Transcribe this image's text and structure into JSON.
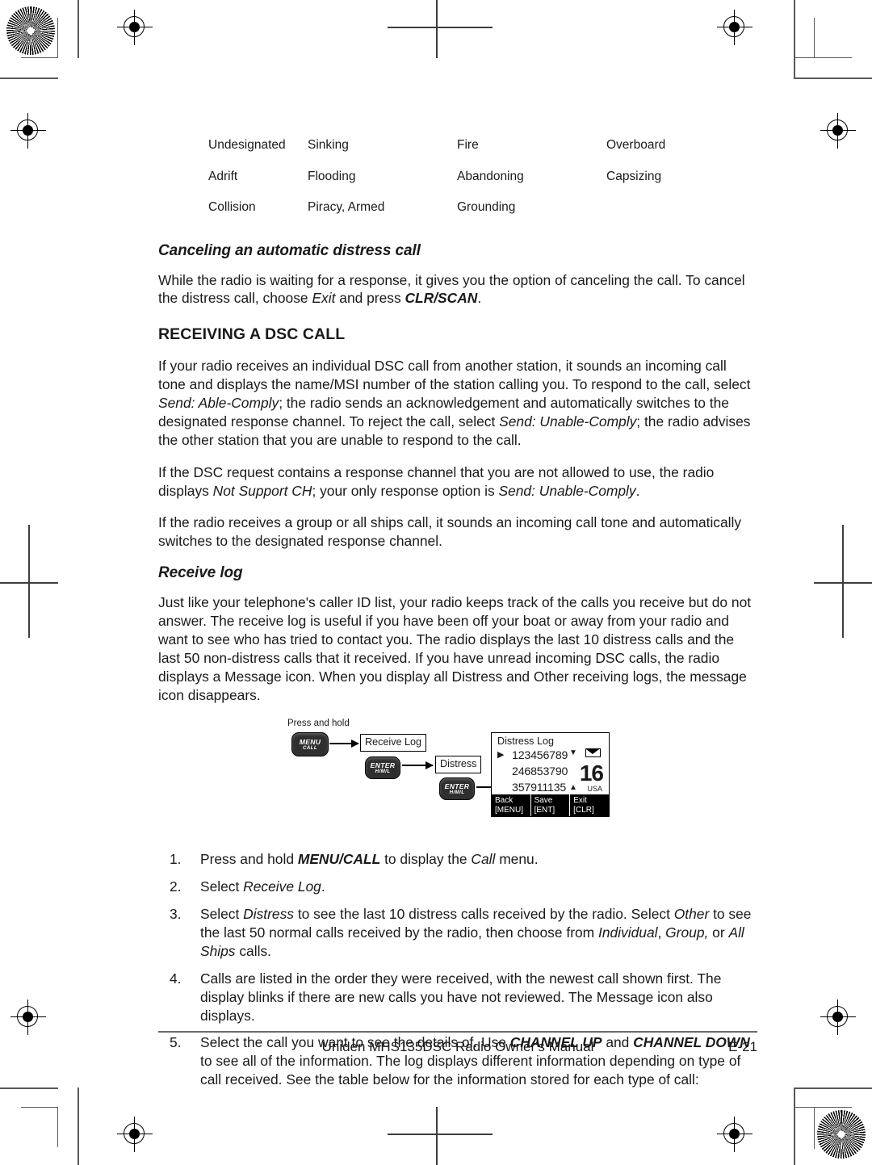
{
  "document": {
    "footer_title": "Uniden MHS135DSC Radio Owner's Manual",
    "page_number": "E-21"
  },
  "distress_categories": {
    "rows": [
      [
        "Undesignated",
        "Sinking",
        "Fire",
        "Overboard"
      ],
      [
        "Adrift",
        "Flooding",
        "Abandoning",
        "Capsizing"
      ],
      [
        "Collision",
        "Piracy, Armed",
        "Grounding",
        ""
      ]
    ]
  },
  "canceling_section": {
    "heading": "Canceling an automatic distress call",
    "paragraph_parts": {
      "p1a": "While the radio is waiting for a response, it gives you the option of canceling the call. To cancel the distress call, choose ",
      "p1_italic": "Exit",
      "p1b": " and press ",
      "p1_bold": "CLR/SCAN",
      "p1c": "."
    }
  },
  "receiving_section": {
    "heading": "RECEIVING A DSC CALL",
    "p1": {
      "a": "If your radio receives an individual DSC call from another station, it sounds an incoming call tone and displays the name/MSI number of the station calling you. To respond to the call, select ",
      "i1": "Send: Able-Comply",
      "b": "; the radio sends an acknowledgement and automatically switches to the designated response channel. To reject the call, select ",
      "i2": "Send: Unable-Comply",
      "c": "; the radio advises the other station that you are unable to respond to the call."
    },
    "p2": {
      "a": "If the DSC request contains a response channel that you are not allowed to use, the radio displays ",
      "i1": "Not Support CH",
      "b": "; your only response option is ",
      "i2": "Send: Unable-Comply",
      "c": "."
    },
    "p3": "If the radio receives a group or all ships call, it sounds an incoming call tone and automatically switches to the designated response channel."
  },
  "receive_log_section": {
    "heading": "Receive log",
    "p1": "Just like your telephone's caller ID list, your radio keeps track of the calls you receive but do not answer. The receive log is useful if you have been off your boat or away from your radio and want to see who has tried to contact you. The radio displays the last 10 distress calls and the last 50 non-distress calls that it received. If you have unread incoming DSC calls, the radio displays a Message icon. When you display all Distress and Other receiving logs, the message icon disappears."
  },
  "diagram": {
    "press_and_hold_label": "Press and hold",
    "menu_key": {
      "line1": "MENU",
      "line2": "CALL"
    },
    "enter_key_1": {
      "line1": "ENTER",
      "line2": "H/M/L"
    },
    "enter_key_2": {
      "line1": "ENTER",
      "line2": "H/M/L"
    },
    "menu_item_1": "Receive Log",
    "menu_item_2": "Distress",
    "lcd": {
      "title": "Distress Log",
      "caret": "▶",
      "entries": [
        "123456789",
        "246853790",
        "357911135"
      ],
      "scroll_down": "▼",
      "scroll_up": "▲",
      "channel": "16",
      "region": "USA",
      "message_icon": "envelope-icon",
      "softkeys": [
        {
          "label": "Back",
          "key": "[MENU]"
        },
        {
          "label": "Save",
          "key": "[ENT]"
        },
        {
          "label": "Exit",
          "key": "[CLR]"
        }
      ]
    }
  },
  "steps": [
    {
      "num": "1.",
      "parts": [
        {
          "t": "Press and hold ",
          "s": "n"
        },
        {
          "t": "MENU/CALL",
          "s": "b"
        },
        {
          "t": " to display the ",
          "s": "n"
        },
        {
          "t": "Call",
          "s": "i"
        },
        {
          "t": " menu.",
          "s": "n"
        }
      ]
    },
    {
      "num": "2.",
      "parts": [
        {
          "t": "Select ",
          "s": "n"
        },
        {
          "t": "Receive Log",
          "s": "i"
        },
        {
          "t": ".",
          "s": "n"
        }
      ]
    },
    {
      "num": "3.",
      "parts": [
        {
          "t": "Select ",
          "s": "n"
        },
        {
          "t": "Distress",
          "s": "i"
        },
        {
          "t": " to see the last 10 distress calls received by the radio. Select ",
          "s": "n"
        },
        {
          "t": "Other",
          "s": "i"
        },
        {
          "t": " to see the last 50 normal calls received by the radio, then choose from ",
          "s": "n"
        },
        {
          "t": "Individual",
          "s": "i"
        },
        {
          "t": ", ",
          "s": "n"
        },
        {
          "t": "Group,",
          "s": "i"
        },
        {
          "t": " or ",
          "s": "n"
        },
        {
          "t": "All Ships",
          "s": "i"
        },
        {
          "t": " calls.",
          "s": "n"
        }
      ]
    },
    {
      "num": "4.",
      "parts": [
        {
          "t": "Calls are listed in the order they were received, with the newest call shown first. The display blinks if there are new calls you have not reviewed. The Message icon also displays.",
          "s": "n"
        }
      ]
    },
    {
      "num": "5.",
      "parts": [
        {
          "t": "Select the call you want to see the details of. Use ",
          "s": "n"
        },
        {
          "t": "CHANNEL UP",
          "s": "b"
        },
        {
          "t": " and ",
          "s": "n"
        },
        {
          "t": "CHANNEL DOWN",
          "s": "b"
        },
        {
          "t": " to see all of the information. The log displays different information depending on type of call received. See the table below for the information stored for each type of call:",
          "s": "n"
        }
      ]
    }
  ],
  "colors": {
    "text": "#1a1a1a",
    "keycap": "#2f2f2f",
    "crop_mark": "#58585a",
    "lcd_softkey_bg": "#000000"
  }
}
